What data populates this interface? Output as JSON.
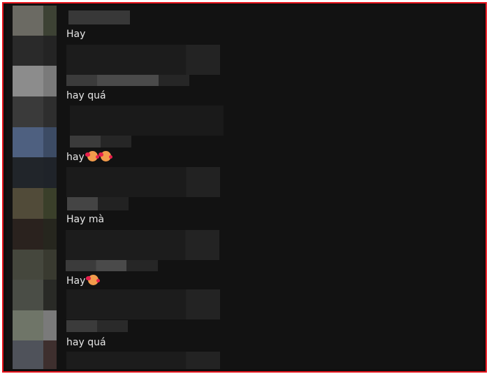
{
  "comments": [
    {
      "text": "Hay",
      "reactions": []
    },
    {
      "text": "hay quá",
      "reactions": []
    },
    {
      "text": "hay",
      "reactions": [
        "smiling-face-with-hearts",
        "smiling-face-with-hearts"
      ]
    },
    {
      "text": "Hay mà",
      "reactions": []
    },
    {
      "text": "Hay",
      "reactions": [
        "smiling-face-with-hearts"
      ]
    },
    {
      "text": "hay quá",
      "reactions": []
    }
  ],
  "colors": {
    "frame_border": "#e8141c",
    "background": "#121212",
    "text": "#e6e6e6"
  }
}
